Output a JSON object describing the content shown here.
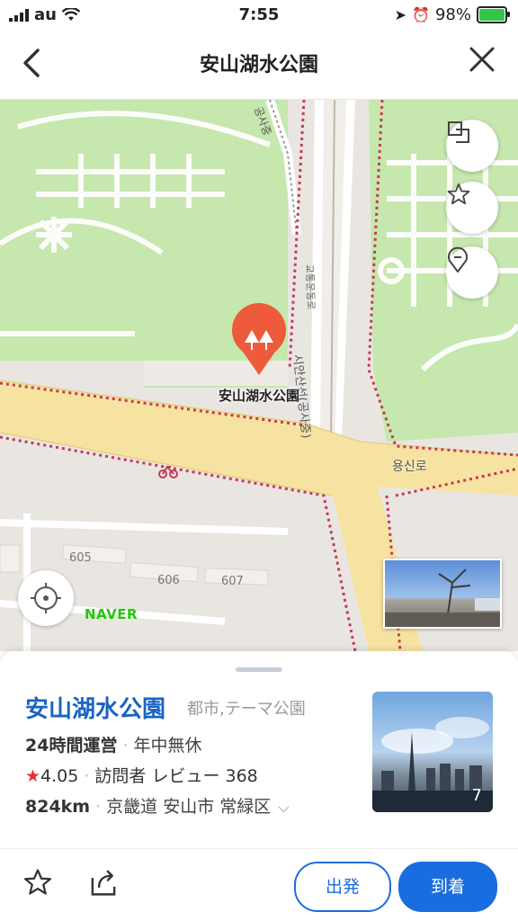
{
  "status_bar": {
    "carrier": "au",
    "time": "7:55",
    "battery": "98%"
  },
  "header": {
    "title": "安山湖水公園",
    "back_icon": "chevron-left-icon",
    "close_icon": "close-icon"
  },
  "map": {
    "poi_label": "安山湖水公園",
    "road_label": "용신로",
    "vertical_road_label": "시안산선(공사중)",
    "upper_road_label": "공사중",
    "right_road_label": "교통운동로",
    "building_numbers": [
      "605",
      "606",
      "607"
    ],
    "naver_logo": "NAVER",
    "buttons": [
      "layers-icon",
      "star-icon",
      "pin-icon",
      "locate-icon"
    ]
  },
  "place": {
    "name": "安山湖水公園",
    "category": "都市,テーマ公園",
    "hours": "24時間運営",
    "hours_note": "年中無休",
    "rating": "4.05",
    "visitor_review_label": "訪問者 レビュー",
    "visitor_review_count": "368",
    "distance": "824km",
    "address": "京畿道 安山市 常緑区",
    "photo_count": "7"
  },
  "actions": {
    "depart": "出発",
    "arrive": "到着"
  },
  "colors": {
    "accent": "#1a6de0",
    "name_blue": "#1a63c4",
    "park_green": "#c6e7ad",
    "road_yellow": "#f7e3a1",
    "poi_red": "#ee5a3c"
  }
}
